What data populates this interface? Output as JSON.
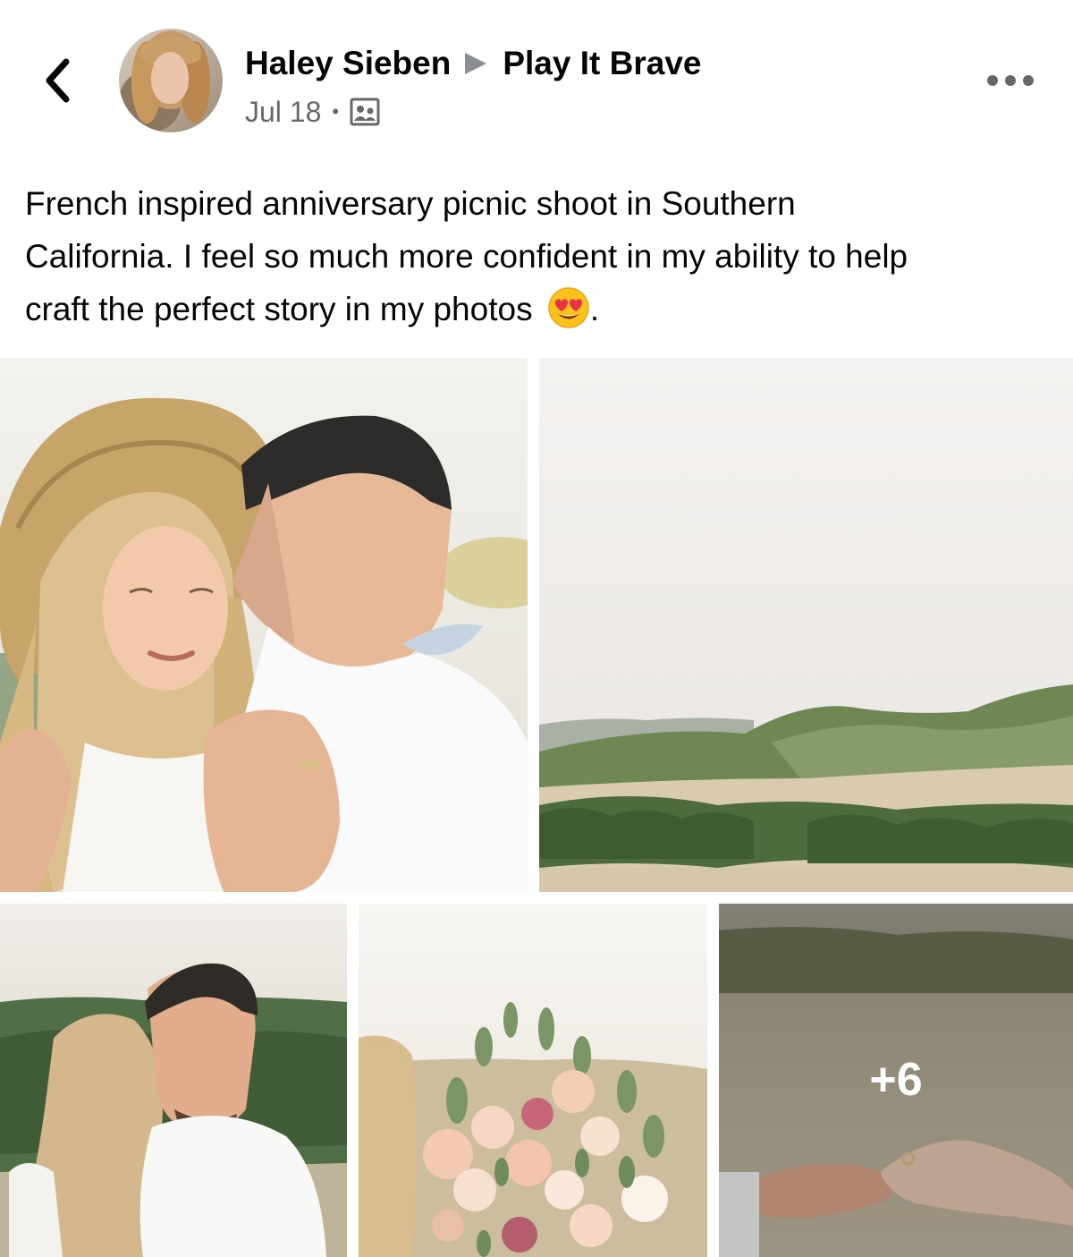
{
  "post": {
    "author_name": "Haley Sieben",
    "group_name": "Play It Brave",
    "date": "Jul 18",
    "audience_icon": "group-icon",
    "text_line1": "French inspired anniversary picnic shoot in Southern",
    "text_line2": "California. I feel so much more confident in my ability to help",
    "text_line3": "craft the perfect story in my photos",
    "text_end": ".",
    "emoji": "heart-eyes-emoji"
  },
  "photos": {
    "items": [
      {
        "subject": "couple-kiss-cheek-straw-hat"
      },
      {
        "subject": "hills-landscape"
      },
      {
        "subject": "couple-embrace"
      },
      {
        "subject": "flower-bouquet"
      },
      {
        "subject": "holding-hands-ring"
      }
    ],
    "more_count": "+6"
  },
  "colors": {
    "text": "#050505",
    "secondary_text": "#65676b",
    "overlay_text": "#ffffff"
  }
}
